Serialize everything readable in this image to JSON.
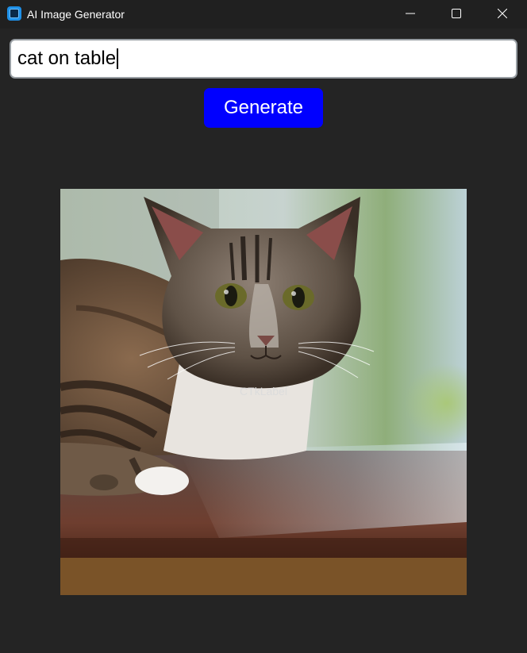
{
  "window": {
    "title": "AI Image Generator"
  },
  "prompt": {
    "value": "cat on table"
  },
  "generate_button": {
    "label": "Generate",
    "color": "#0000ff"
  },
  "image_label": {
    "text": "CTkLabel"
  },
  "colors": {
    "background": "#242424",
    "titlebar": "#202020",
    "accent": "#0000ff"
  }
}
